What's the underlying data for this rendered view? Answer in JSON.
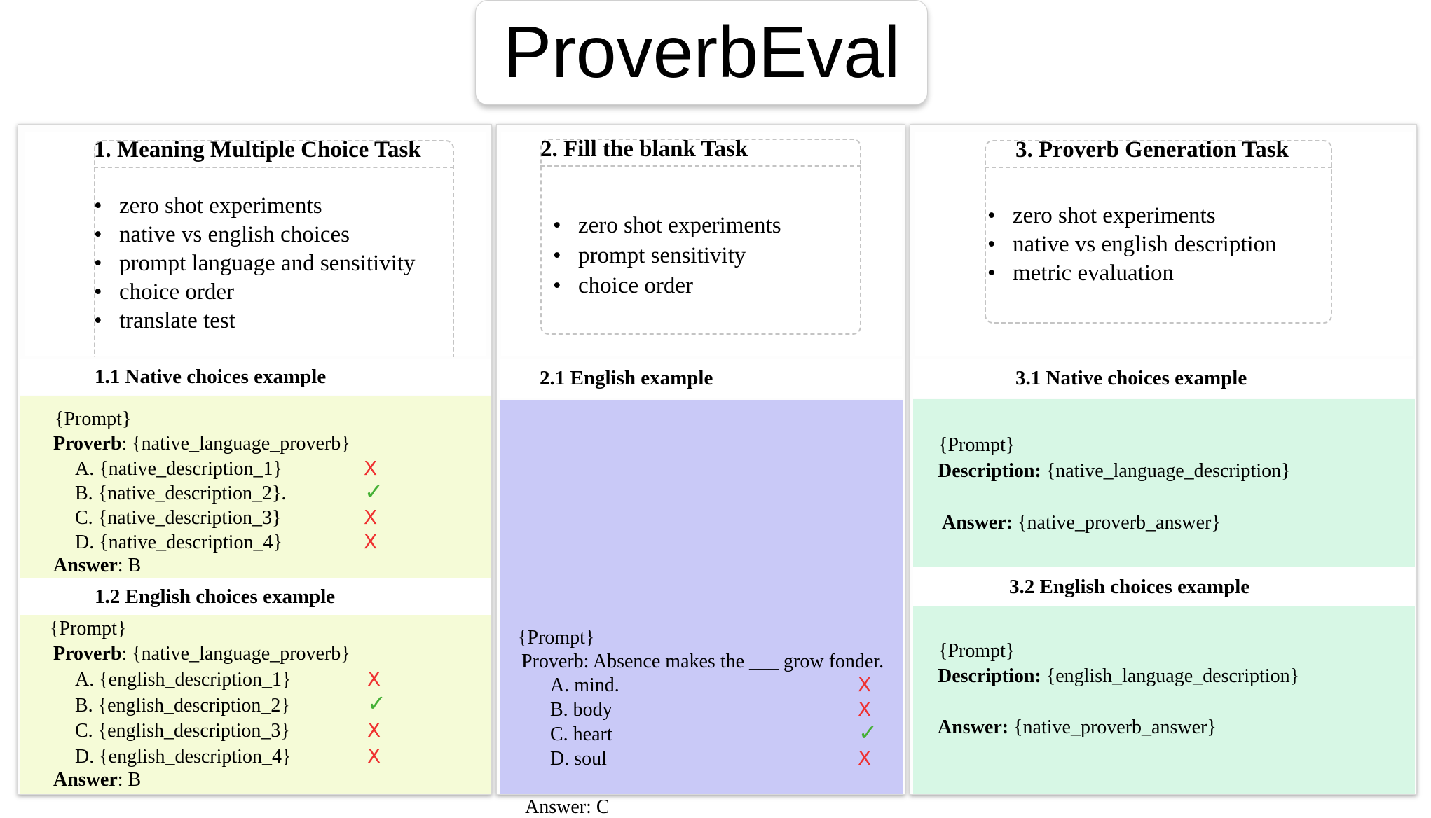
{
  "title": "ProverbEval",
  "panel1": {
    "task_title": "1. Meaning Multiple Choice Task",
    "bullets": [
      "zero shot experiments",
      "native vs english choices",
      "prompt language and sensitivity",
      "choice order",
      "translate test"
    ],
    "ex1": {
      "heading": "1.1 Native choices example",
      "prompt": "{Prompt}",
      "proverb_label": "Proverb",
      "proverb_value": ": {native_language_proverb}",
      "choices": [
        "A. {native_description_1}",
        "B. {native_description_2}.",
        "C. {native_description_3}",
        "D. {native_description_4}"
      ],
      "marks": [
        "X",
        "✓",
        "X",
        "X"
      ],
      "answer_label": "Answer",
      "answer_value": ": B"
    },
    "ex2": {
      "heading": "1.2 English choices example",
      "prompt": "{Prompt}",
      "proverb_label": "Proverb",
      "proverb_value": ": {native_language_proverb}",
      "choices": [
        "A. {english_description_1}",
        "B. {english_description_2}",
        "C. {english_description_3}",
        "D. {english_description_4}"
      ],
      "marks": [
        "X",
        "✓",
        "X",
        "X"
      ],
      "answer_label": "Answer",
      "answer_value": ": B"
    }
  },
  "panel2": {
    "task_title": "2. Fill the blank Task",
    "bullets": [
      "zero shot experiments",
      "prompt sensitivity",
      "choice order"
    ],
    "ex1": {
      "heading": "2.1 English example",
      "prompt": "{Prompt}",
      "proverb_line": "Proverb: Absence makes the ___ grow fonder.",
      "choices": [
        "A. mind.",
        "B. body",
        "C. heart",
        "D. soul"
      ],
      "marks": [
        "X",
        "X",
        "✓",
        "X"
      ],
      "answer": "Answer: C"
    }
  },
  "panel3": {
    "task_title": "3. Proverb Generation Task",
    "bullets": [
      "zero shot experiments",
      "native vs english description",
      "metric evaluation"
    ],
    "ex1": {
      "heading": "3.1 Native choices example",
      "prompt": "{Prompt}",
      "desc_label": "Description:",
      "desc_value": " {native_language_description}",
      "answer_label": "Answer:",
      "answer_value": " {native_proverb_answer}"
    },
    "ex2": {
      "heading": "3.2 English choices example",
      "prompt": "{Prompt}",
      "desc_label": "Description:",
      "desc_value": " {english_language_description}",
      "answer_label": "Answer:",
      "answer_value": " {native_proverb_answer}"
    }
  },
  "colors": {
    "panel1_fill": "#f5fbd7",
    "panel2_fill": "#c9c9f7",
    "panel3_fill": "#d7f7e5",
    "x_mark": "#ef3030",
    "check_mark": "#44b035"
  }
}
